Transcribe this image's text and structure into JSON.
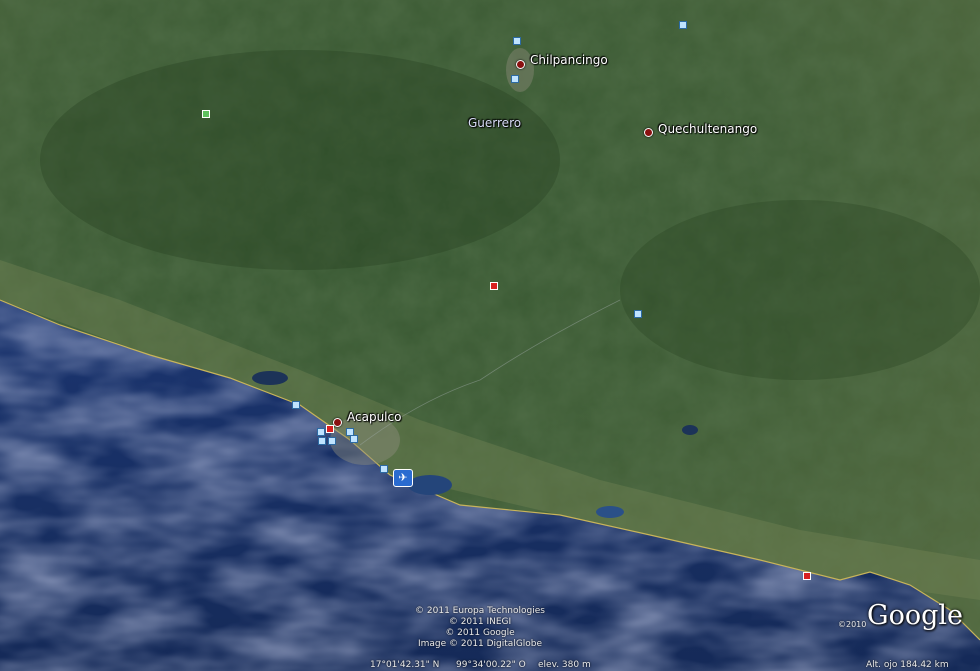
{
  "places": {
    "chilpancingo": "Chilpancingo",
    "quechultenango": "Quechultenango",
    "guerrero": "Guerrero",
    "acapulco": "Acapulco"
  },
  "credits": {
    "line1": "© 2011 Europa Technologies",
    "line2": "© 2011 INEGI",
    "line3": "© 2011 Google",
    "line4": "Image © 2011 DigitalGlobe"
  },
  "logo": {
    "text": "Google",
    "year": "©2010"
  },
  "status": {
    "lat": "17°01'42.31\" N",
    "lon": "99°34'00.22\" O",
    "elev": "elev.  380 m",
    "eye": "Alt. ojo   184.42 km"
  },
  "colors": {
    "land": "#3c5a34",
    "ocean": "#1e3a78",
    "coast": "#c8b45a"
  },
  "icons": {
    "city": "city-marker-icon",
    "poi": "poi-square-icon",
    "airport": "airport-icon"
  }
}
